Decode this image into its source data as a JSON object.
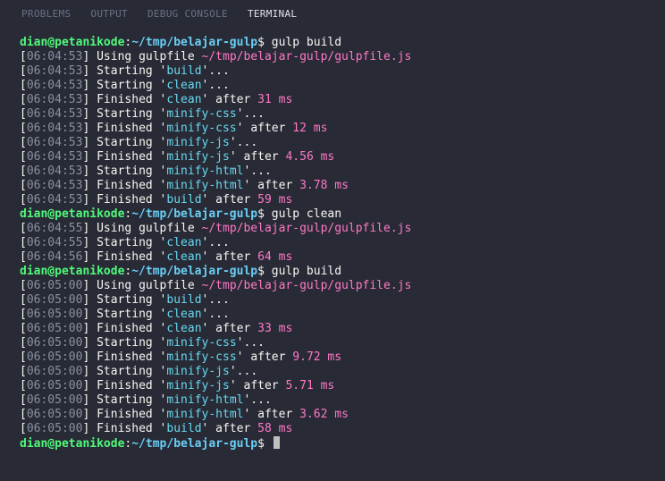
{
  "tabs": [
    "PROBLEMS",
    "OUTPUT",
    "DEBUG CONSOLE",
    "TERMINAL"
  ],
  "activeTab": 3,
  "prompt": {
    "user": "dian@petanikode",
    "sep": ":",
    "path": "~/tmp/belajar-gulp",
    "sigil": "$"
  },
  "gulpfile_prefix": "Using gulpfile ",
  "gulpfile_path": "~/tmp/belajar-gulp/gulpfile.js",
  "sessions": [
    {
      "command": "gulp build",
      "lines": [
        {
          "ts": "06:04:53",
          "kind": "gulpfile"
        },
        {
          "ts": "06:04:53",
          "kind": "start",
          "task": "build"
        },
        {
          "ts": "06:04:53",
          "kind": "start",
          "task": "clean"
        },
        {
          "ts": "06:04:53",
          "kind": "finish",
          "task": "clean",
          "dur": "31 ms"
        },
        {
          "ts": "06:04:53",
          "kind": "start",
          "task": "minify-css"
        },
        {
          "ts": "06:04:53",
          "kind": "finish",
          "task": "minify-css",
          "dur": "12 ms"
        },
        {
          "ts": "06:04:53",
          "kind": "start",
          "task": "minify-js"
        },
        {
          "ts": "06:04:53",
          "kind": "finish",
          "task": "minify-js",
          "dur": "4.56 ms"
        },
        {
          "ts": "06:04:53",
          "kind": "start",
          "task": "minify-html"
        },
        {
          "ts": "06:04:53",
          "kind": "finish",
          "task": "minify-html",
          "dur": "3.78 ms"
        },
        {
          "ts": "06:04:53",
          "kind": "finish",
          "task": "build",
          "dur": "59 ms"
        }
      ]
    },
    {
      "command": "gulp clean",
      "lines": [
        {
          "ts": "06:04:55",
          "kind": "gulpfile"
        },
        {
          "ts": "06:04:55",
          "kind": "start",
          "task": "clean"
        },
        {
          "ts": "06:04:56",
          "kind": "finish",
          "task": "clean",
          "dur": "64 ms"
        }
      ]
    },
    {
      "command": "gulp build",
      "lines": [
        {
          "ts": "06:05:00",
          "kind": "gulpfile"
        },
        {
          "ts": "06:05:00",
          "kind": "start",
          "task": "build"
        },
        {
          "ts": "06:05:00",
          "kind": "start",
          "task": "clean"
        },
        {
          "ts": "06:05:00",
          "kind": "finish",
          "task": "clean",
          "dur": "33 ms"
        },
        {
          "ts": "06:05:00",
          "kind": "start",
          "task": "minify-css"
        },
        {
          "ts": "06:05:00",
          "kind": "finish",
          "task": "minify-css",
          "dur": "9.72 ms"
        },
        {
          "ts": "06:05:00",
          "kind": "start",
          "task": "minify-js"
        },
        {
          "ts": "06:05:00",
          "kind": "finish",
          "task": "minify-js",
          "dur": "5.71 ms"
        },
        {
          "ts": "06:05:00",
          "kind": "start",
          "task": "minify-html"
        },
        {
          "ts": "06:05:00",
          "kind": "finish",
          "task": "minify-html",
          "dur": "3.62 ms"
        },
        {
          "ts": "06:05:00",
          "kind": "finish",
          "task": "build",
          "dur": "58 ms"
        }
      ]
    }
  ]
}
